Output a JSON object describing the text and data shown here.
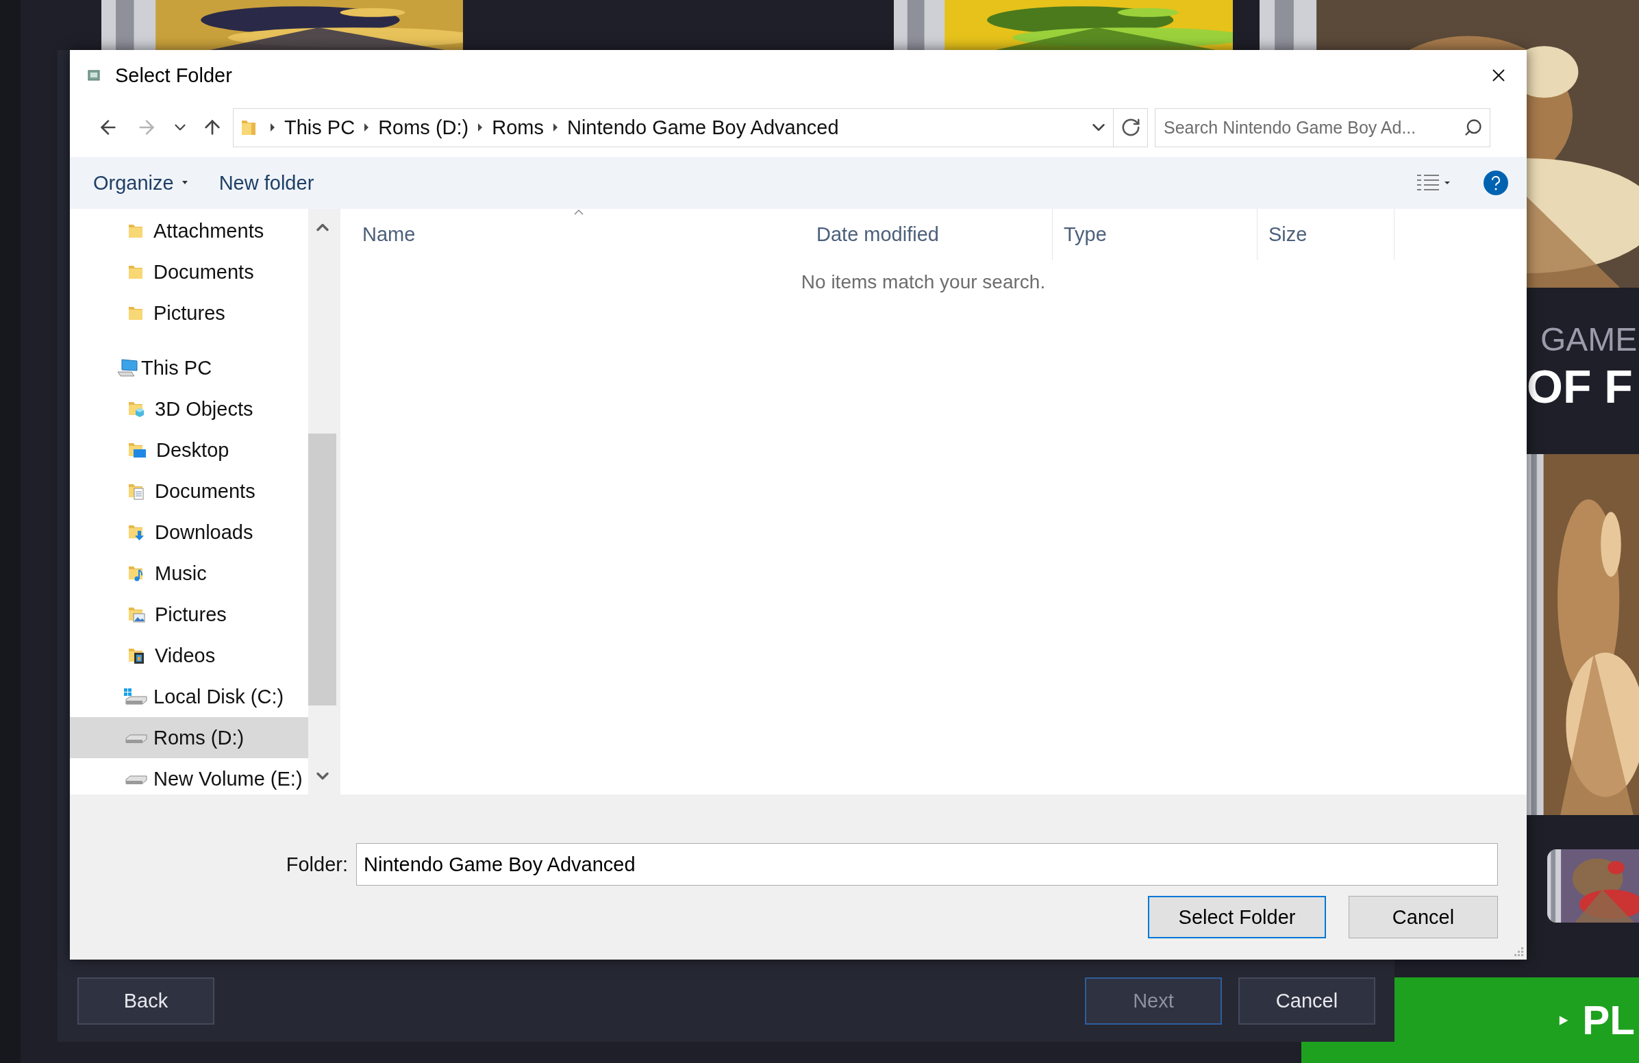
{
  "background": {
    "side_panel": {
      "subtitle": "GAME",
      "heading": "OF F",
      "play_button": {
        "label": "PL"
      }
    },
    "wizard_buttons": [
      {
        "label": "Back",
        "disabled": false,
        "focused": false
      },
      {
        "label": "Next",
        "disabled": true,
        "focused": true
      },
      {
        "label": "Cancel",
        "disabled": false,
        "focused": false
      }
    ]
  },
  "dialog": {
    "title": "Select Folder",
    "breadcrumb": [
      "This PC",
      "Roms (D:)",
      "Roms",
      "Nintendo Game Boy Advanced"
    ],
    "search": {
      "placeholder": "Search Nintendo Game Boy Ad..."
    },
    "toolbar": {
      "organize": "Organize",
      "new_folder": "New folder"
    },
    "nav": [
      {
        "children": [
          {
            "label": "Attachments",
            "kind": "folder",
            "selected": false
          },
          {
            "label": "Documents",
            "kind": "folder",
            "selected": false
          },
          {
            "label": "Pictures",
            "kind": "folder",
            "selected": false
          }
        ]
      },
      {
        "label": "This PC",
        "kind": "pc",
        "selected": false,
        "children": [
          {
            "label": "3D Objects",
            "kind": "objects3d",
            "selected": false
          },
          {
            "label": "Desktop",
            "kind": "desktop",
            "selected": false
          },
          {
            "label": "Documents",
            "kind": "documents",
            "selected": false
          },
          {
            "label": "Downloads",
            "kind": "downloads",
            "selected": false
          },
          {
            "label": "Music",
            "kind": "music",
            "selected": false
          },
          {
            "label": "Pictures",
            "kind": "pictures",
            "selected": false
          },
          {
            "label": "Videos",
            "kind": "videos",
            "selected": false
          },
          {
            "label": "Local Disk (C:)",
            "kind": "system_drive",
            "selected": false
          },
          {
            "label": "Roms (D:)",
            "kind": "drive",
            "selected": true
          },
          {
            "label": "New Volume (E:)",
            "kind": "drive",
            "selected": false
          }
        ]
      }
    ],
    "columns": [
      {
        "label": "Name",
        "sorted": true
      },
      {
        "label": "Date modified",
        "sorted": false
      },
      {
        "label": "Type",
        "sorted": false
      },
      {
        "label": "Size",
        "sorted": false
      }
    ],
    "empty_message": "No items match your search.",
    "folder_field": {
      "label": "Folder:",
      "value": "Nintendo Game Boy Advanced"
    },
    "buttons": [
      {
        "label": "Select Folder",
        "default": true
      },
      {
        "label": "Cancel",
        "default": false
      }
    ]
  }
}
